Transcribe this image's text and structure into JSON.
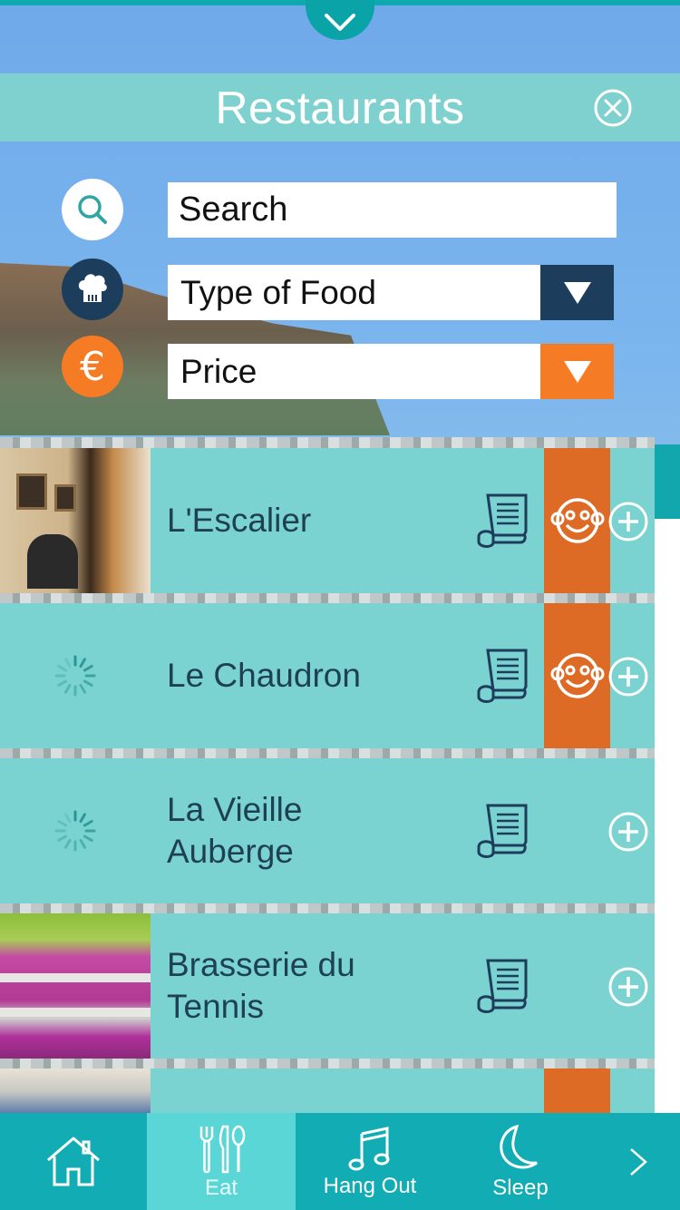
{
  "header": {
    "title": "Restaurants"
  },
  "filters": {
    "search_placeholder": "Search",
    "food_type": "Type of Food",
    "price": "Price",
    "food_arrow_color": "#1d3d5c",
    "price_arrow_color": "#f57c24"
  },
  "restaurants": [
    {
      "name_line1": "L'Escalier",
      "name_line2": "",
      "has_photo": true,
      "featured": true
    },
    {
      "name_line1": "Le Chaudron",
      "name_line2": "",
      "has_photo": false,
      "featured": true
    },
    {
      "name_line1": "La Vieille",
      "name_line2": "Auberge",
      "has_photo": false,
      "featured": false
    },
    {
      "name_line1": "Brasserie du",
      "name_line2": "Tennis",
      "has_photo": true,
      "featured": false
    }
  ],
  "tabs": [
    {
      "label": "",
      "icon": "home-icon"
    },
    {
      "label": "Eat",
      "icon": "cutlery-icon"
    },
    {
      "label": "Hang Out",
      "icon": "music-note-icon"
    },
    {
      "label": "Sleep",
      "icon": "moon-icon"
    }
  ],
  "colors": {
    "accent": "#7ad3d0",
    "teal": "#12adb4",
    "orange": "#dd6a25",
    "navy": "#1d3d5c"
  }
}
